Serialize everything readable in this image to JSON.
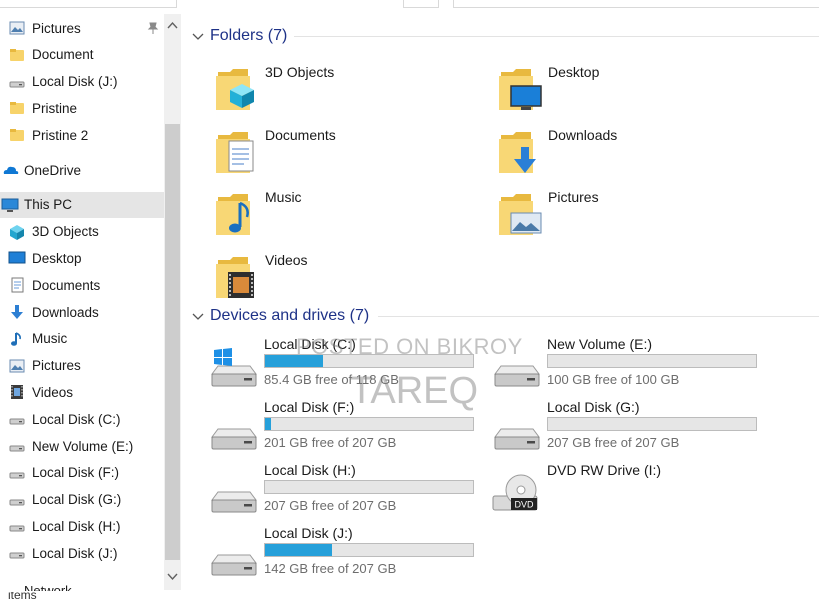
{
  "nav": {
    "items": [
      {
        "label": "Pictures",
        "icon": "pictures-icon",
        "pinned": true
      },
      {
        "label": "Document",
        "icon": "folder-icon"
      },
      {
        "label": "Local Disk  (J:)",
        "icon": "drive-icon"
      },
      {
        "label": "Pristine",
        "icon": "folder-icon"
      },
      {
        "label": "Pristine 2",
        "icon": "folder-icon"
      },
      {
        "label": "OneDrive",
        "icon": "onedrive-icon"
      },
      {
        "label": "This PC",
        "icon": "this-pc-icon",
        "selected": true
      },
      {
        "label": "3D Objects",
        "icon": "3d-objects-icon"
      },
      {
        "label": "Desktop",
        "icon": "desktop-icon"
      },
      {
        "label": "Documents",
        "icon": "documents-icon"
      },
      {
        "label": "Downloads",
        "icon": "downloads-icon"
      },
      {
        "label": "Music",
        "icon": "music-icon"
      },
      {
        "label": "Pictures",
        "icon": "pictures-icon"
      },
      {
        "label": "Videos",
        "icon": "videos-icon"
      },
      {
        "label": "Local Disk (C:)",
        "icon": "drive-icon"
      },
      {
        "label": "New Volume (E:)",
        "icon": "drive-icon"
      },
      {
        "label": "Local Disk  (F:)",
        "icon": "drive-icon"
      },
      {
        "label": "Local Disk (G:)",
        "icon": "drive-icon"
      },
      {
        "label": "Local Disk  (H:)",
        "icon": "drive-icon"
      },
      {
        "label": "Local Disk  (J:)",
        "icon": "drive-icon"
      }
    ],
    "partial_label": "Network"
  },
  "folders": {
    "title": "Folders (7)",
    "items": [
      {
        "label": "3D Objects",
        "icon": "3d-objects-folder-icon"
      },
      {
        "label": "Desktop",
        "icon": "desktop-folder-icon"
      },
      {
        "label": "Documents",
        "icon": "documents-folder-icon"
      },
      {
        "label": "Downloads",
        "icon": "downloads-folder-icon"
      },
      {
        "label": "Music",
        "icon": "music-folder-icon"
      },
      {
        "label": "Pictures",
        "icon": "pictures-folder-icon"
      },
      {
        "label": "Videos",
        "icon": "videos-folder-icon"
      }
    ]
  },
  "drives": {
    "title": "Devices and drives (7)",
    "items": [
      {
        "label": "Local Disk (C:)",
        "free": "85.4 GB free of 118 GB",
        "used_fraction": 0.28,
        "icon": "windows-drive-icon"
      },
      {
        "label": "New Volume (E:)",
        "free": "100 GB free of 100 GB",
        "used_fraction": 0.0,
        "icon": "drive-icon"
      },
      {
        "label": "Local Disk  (F:)",
        "free": "201 GB free of 207 GB",
        "used_fraction": 0.03,
        "icon": "drive-icon"
      },
      {
        "label": "Local Disk (G:)",
        "free": "207 GB free of 207 GB",
        "used_fraction": 0.0,
        "icon": "drive-icon"
      },
      {
        "label": "Local Disk  (H:)",
        "free": "207 GB free of 207 GB",
        "used_fraction": 0.0,
        "icon": "drive-icon"
      },
      {
        "label": "DVD RW Drive (I:)",
        "free": "",
        "icon": "dvd-drive-icon"
      },
      {
        "label": "Local Disk  (J:)",
        "free": "142 GB free of 207 GB",
        "used_fraction": 0.32,
        "icon": "drive-icon"
      }
    ]
  },
  "watermark": {
    "line1": "POSTED ON BIKROY",
    "line2": "TAREQ"
  },
  "status": {
    "text": "items"
  },
  "colors": {
    "accent": "#26a0da",
    "section_title": "#1e3287",
    "selected": "#e5e5e5"
  }
}
